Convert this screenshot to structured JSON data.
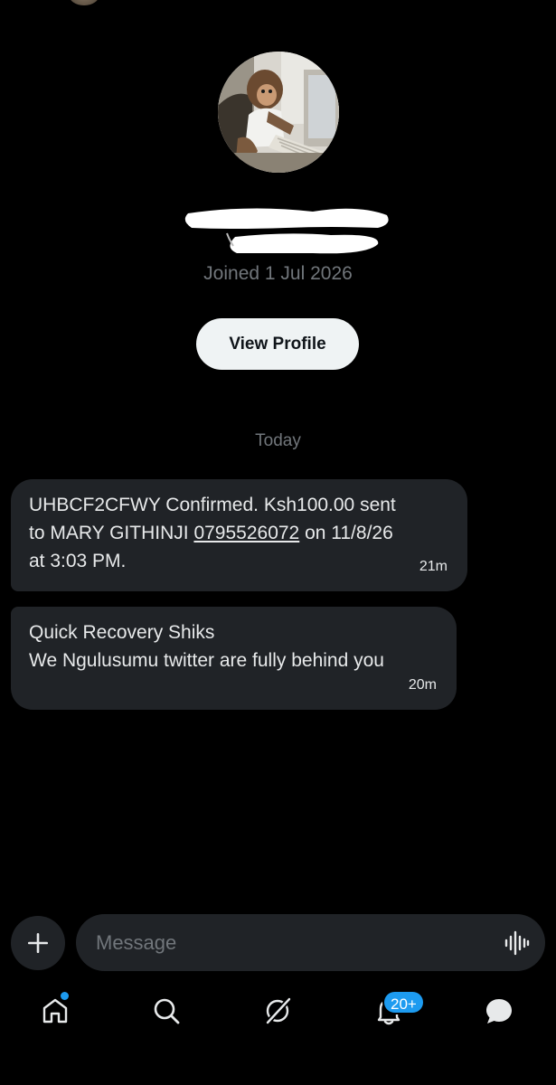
{
  "profile": {
    "joined": "Joined 1 Jul 2026",
    "view_profile_label": "View Profile"
  },
  "conversation": {
    "day_separator": "Today",
    "messages": [
      {
        "line1": "UHBCF2CFWY Confirmed. Ksh100.00 sent",
        "line2_prefix": "to MARY  GITHINJI ",
        "line2_phone": "0795526072",
        "line2_suffix": " on 11/8/26",
        "line3": "at 3:03 PM.",
        "time": "21m"
      },
      {
        "line1": "Quick Recovery Shiks",
        "line2": "We Ngulusumu twitter  are fully behind you",
        "time": "20m"
      }
    ]
  },
  "composer": {
    "placeholder": "Message",
    "add_icon": "plus-icon",
    "voice_icon": "voice-wave-icon"
  },
  "bottom_nav": {
    "items": [
      "home-icon",
      "search-icon",
      "grok-icon",
      "notifications-icon",
      "messages-icon"
    ],
    "notifications_badge": "20+",
    "accent_color": "#1d9bf0"
  }
}
